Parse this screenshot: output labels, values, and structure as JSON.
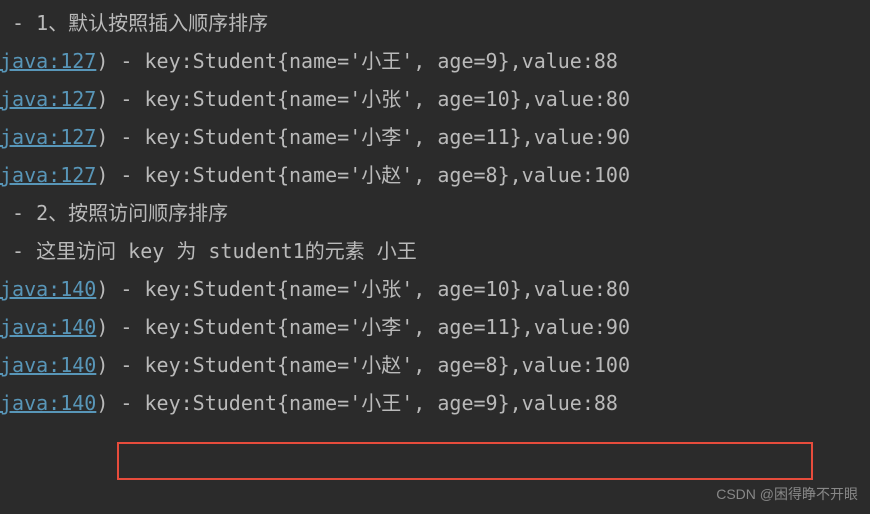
{
  "lines": [
    {
      "type": "header",
      "prefix": " - ",
      "text": "1、默认按照插入顺序排序"
    },
    {
      "type": "log",
      "link": "java:127",
      "sep": ") - ",
      "content": "key:Student{name='小王', age=9},value:88"
    },
    {
      "type": "log",
      "link": "java:127",
      "sep": ") - ",
      "content": "key:Student{name='小张', age=10},value:80"
    },
    {
      "type": "log",
      "link": "java:127",
      "sep": ") - ",
      "content": "key:Student{name='小李', age=11},value:90"
    },
    {
      "type": "log",
      "link": "java:127",
      "sep": ") - ",
      "content": "key:Student{name='小赵', age=8},value:100"
    },
    {
      "type": "header",
      "prefix": " - ",
      "text": "2、按照访问顺序排序"
    },
    {
      "type": "header",
      "prefix": " - ",
      "text": "这里访问 key 为 student1的元素 小王"
    },
    {
      "type": "log",
      "link": "java:140",
      "sep": ") - ",
      "content": "key:Student{name='小张', age=10},value:80"
    },
    {
      "type": "log",
      "link": "java:140",
      "sep": ") - ",
      "content": "key:Student{name='小李', age=11},value:90"
    },
    {
      "type": "log",
      "link": "java:140",
      "sep": ") - ",
      "content": "key:Student{name='小赵', age=8},value:100"
    },
    {
      "type": "log",
      "link": "java:140",
      "sep": ") - ",
      "content": "key:Student{name='小王', age=9},value:88",
      "highlighted": true
    }
  ],
  "watermark": "CSDN @困得睁不开眼"
}
